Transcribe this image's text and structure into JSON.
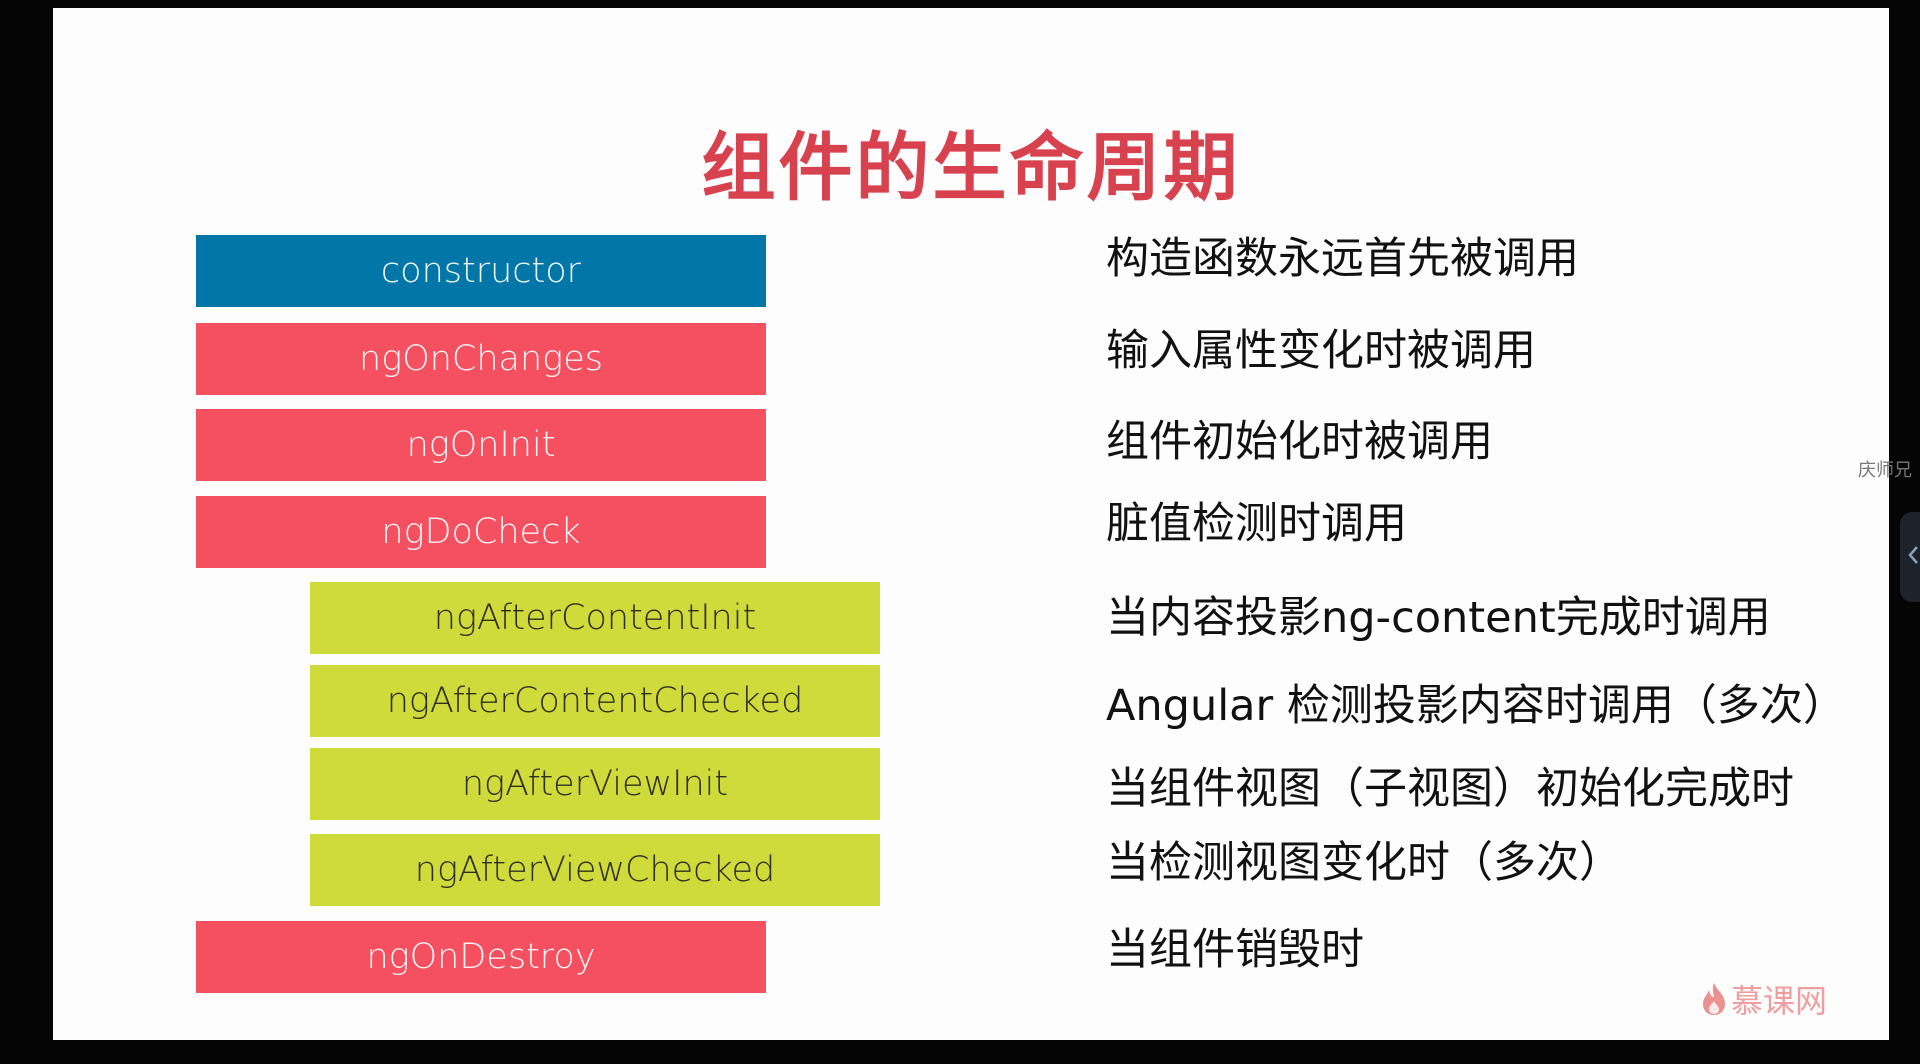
{
  "slide": {
    "title": "组件的生命周期",
    "hooks": [
      {
        "label": "constructor",
        "description": "构造函数永远首先被调用"
      },
      {
        "label": "ngOnChanges",
        "description": "输入属性变化时被调用"
      },
      {
        "label": "ngOnInit",
        "description": "组件初始化时被调用"
      },
      {
        "label": "ngDoCheck",
        "description": "脏值检测时调用"
      },
      {
        "label": "ngAfterContentInit",
        "description": "当内容投影ng-content完成时调用"
      },
      {
        "label": "ngAfterContentChecked",
        "description": "Angular 检测投影内容时调用（多次）"
      },
      {
        "label": "ngAfterViewInit",
        "description": "当组件视图（子视图）初始化完成时"
      },
      {
        "label": "ngAfterViewChecked",
        "description": "当检测视图变化时（多次）"
      },
      {
        "label": "ngOnDestroy",
        "description": "当组件销毁时"
      }
    ],
    "watermark": "慕课网"
  },
  "overlay": {
    "side_label": "庆师兄"
  },
  "colors": {
    "title": "#d8414e",
    "constructor_bar": "#0376a8",
    "lifecycle_bar": "#f4505f",
    "content_view_bar": "#cfdb3a"
  },
  "icons": {
    "watermark_logo": "flame-icon",
    "side_tab": "chevron-left-icon"
  }
}
